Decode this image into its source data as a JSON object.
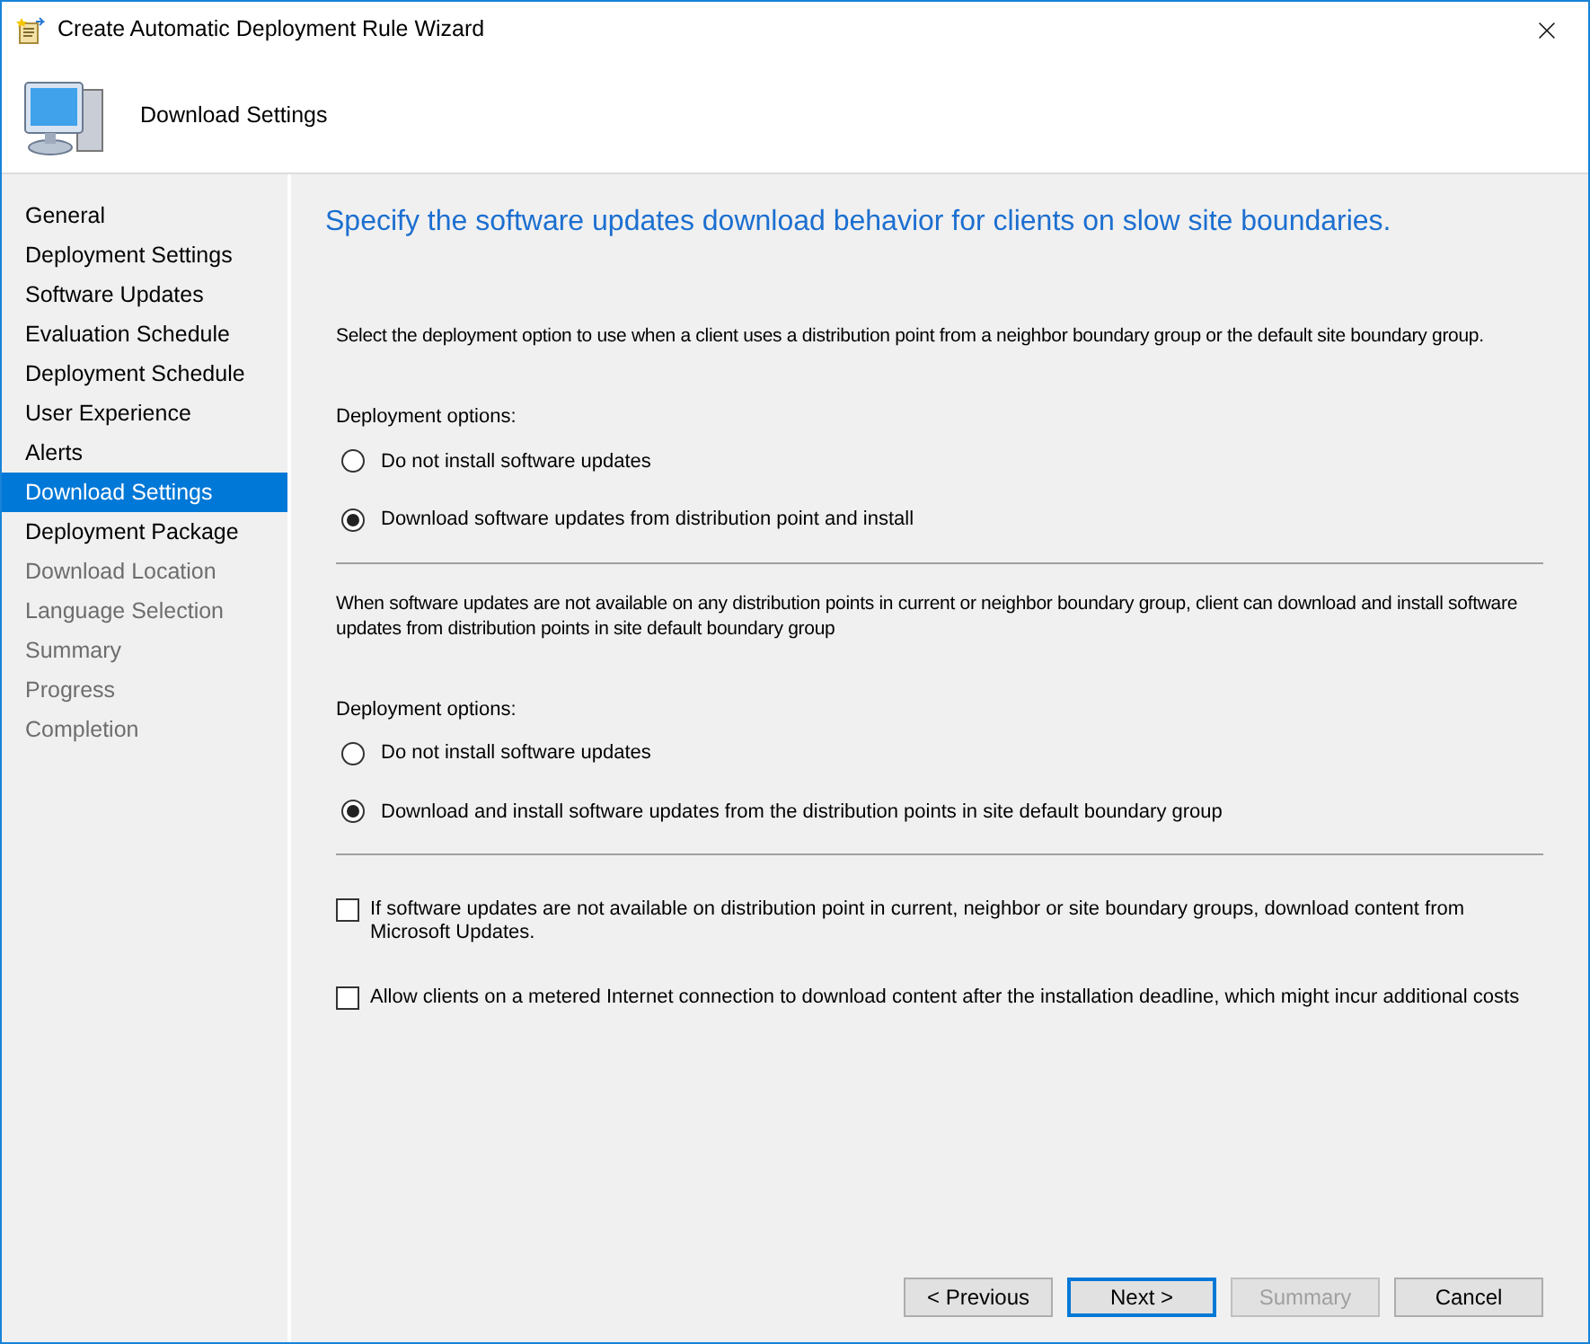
{
  "window": {
    "title": "Create Automatic Deployment Rule Wizard"
  },
  "header": {
    "title": "Download Settings"
  },
  "sidebar": {
    "items": [
      {
        "label": "General",
        "selected": false,
        "disabled": false
      },
      {
        "label": "Deployment Settings",
        "selected": false,
        "disabled": false
      },
      {
        "label": "Software Updates",
        "selected": false,
        "disabled": false
      },
      {
        "label": "Evaluation Schedule",
        "selected": false,
        "disabled": false
      },
      {
        "label": "Deployment Schedule",
        "selected": false,
        "disabled": false
      },
      {
        "label": "User Experience",
        "selected": false,
        "disabled": false
      },
      {
        "label": "Alerts",
        "selected": false,
        "disabled": false
      },
      {
        "label": "Download Settings",
        "selected": true,
        "disabled": false
      },
      {
        "label": "Deployment Package",
        "selected": false,
        "disabled": false
      },
      {
        "label": "Download Location",
        "selected": false,
        "disabled": true
      },
      {
        "label": "Language Selection",
        "selected": false,
        "disabled": true
      },
      {
        "label": "Summary",
        "selected": false,
        "disabled": true
      },
      {
        "label": "Progress",
        "selected": false,
        "disabled": true
      },
      {
        "label": "Completion",
        "selected": false,
        "disabled": true
      }
    ]
  },
  "content": {
    "heading": "Specify the software updates download behavior for clients on slow site boundaries.",
    "sections": [
      {
        "description": "Select the deployment option to use when a client uses a distribution point from a neighbor boundary group or the default site boundary group.",
        "options_label": "Deployment options:",
        "options": [
          {
            "label": "Do not install software updates",
            "selected": false
          },
          {
            "label": "Download software updates from distribution point and install",
            "selected": true
          }
        ]
      },
      {
        "description": "When software updates are not available on any distribution points in current or neighbor boundary group, client can download and install software updates from distribution points in site default boundary group",
        "options_label": "Deployment options:",
        "options": [
          {
            "label": "Do not install software updates",
            "selected": false
          },
          {
            "label": "Download and install software updates from the distribution points in site default boundary group",
            "selected": true
          }
        ]
      }
    ],
    "checkboxes": [
      {
        "label": "If software updates are not available on distribution point in current, neighbor or site boundary groups, download content from Microsoft Updates.",
        "checked": false
      },
      {
        "label": "Allow clients on a metered Internet connection to download content after the installation deadline, which might incur additional costs",
        "checked": false
      }
    ]
  },
  "buttons": [
    {
      "label": "< Previous",
      "disabled": false,
      "default": false
    },
    {
      "label": "Next >",
      "disabled": false,
      "default": true
    },
    {
      "label": "Summary",
      "disabled": true,
      "default": false
    },
    {
      "label": "Cancel",
      "disabled": false,
      "default": false
    }
  ]
}
